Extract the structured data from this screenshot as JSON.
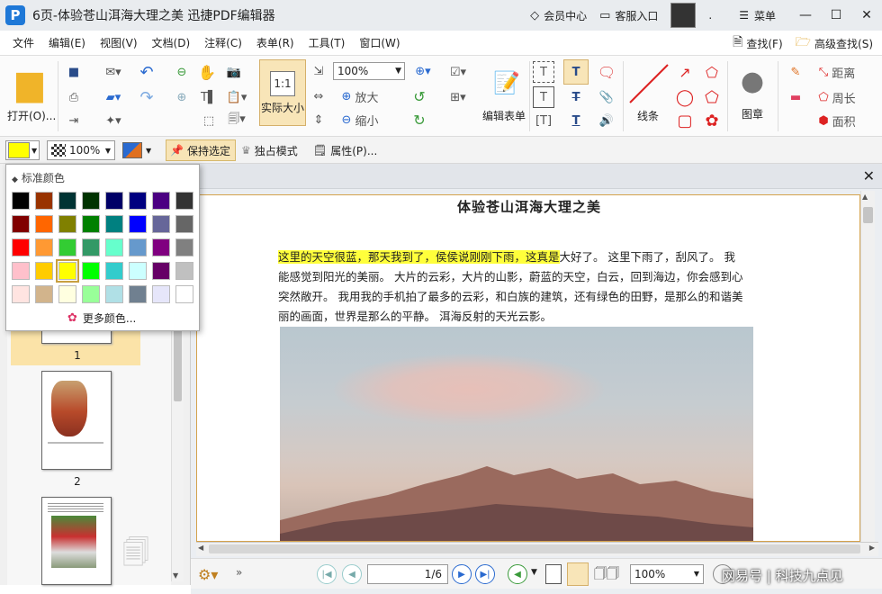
{
  "window": {
    "title": "6页-体验苍山洱海大理之美  迅捷PDF编辑器",
    "member_center": "会员中心",
    "service": "客服入口",
    "dot": ".",
    "menu": "菜单"
  },
  "menubar": {
    "items": [
      "文件",
      "编辑(E)",
      "视图(V)",
      "文档(D)",
      "注释(C)",
      "表单(R)",
      "工具(T)",
      "窗口(W)"
    ],
    "find": "查找(F)",
    "advanced_find": "高级查找(S)"
  },
  "ribbon": {
    "open": "打开(O)...",
    "actual_size": "实际大小",
    "zoom_value": "100%",
    "zoom_in": "放大",
    "zoom_out": "缩小",
    "edit_form": "编辑表单",
    "line": "线条",
    "stamp": "图章",
    "distance": "距离",
    "perimeter": "周长",
    "area": "面积",
    "actual_icon_text": "1:1"
  },
  "props": {
    "opacity": "100%",
    "keep_selected": "保持选定",
    "exclusive_mode": "独占模式",
    "properties": "属性(P)..."
  },
  "palette": {
    "title": "标准颜色",
    "more": "更多颜色...",
    "colors": [
      "#000000",
      "#993300",
      "#003333",
      "#003300",
      "#000066",
      "#000080",
      "#4b0082",
      "#333333",
      "#800000",
      "#ff6600",
      "#808000",
      "#008000",
      "#008080",
      "#0000ff",
      "#666699",
      "#666666",
      "#ff0000",
      "#ff9933",
      "#33cc33",
      "#339966",
      "#66ffcc",
      "#6699cc",
      "#800080",
      "#808080",
      "#ffc0cb",
      "#ffcc00",
      "#ffff00",
      "#00ff00",
      "#33cccc",
      "#ccffff",
      "#660066",
      "#c0c0c0",
      "#ffe4e1",
      "#d2b48c",
      "#ffffe0",
      "#99ff99",
      "#b0e0e6",
      "#708090",
      "#e6e6fa",
      "#ffffff"
    ],
    "selected_index": 26
  },
  "thumbnails": {
    "labels": [
      "1",
      "2"
    ]
  },
  "document": {
    "title": "体验苍山洱海大理之美",
    "highlighted": "这里的天空很蓝，那天我到了，侯侯说刚刚下雨，这真是",
    "para_line1_rest": "大好了。  这里下雨了，刮风了。  我",
    "para_line2": "能感觉到阳光的美丽。  大片的云彩，大片的山影，蔚蓝的天空，白云，回到海边，你会感到心",
    "para_line3": "突然敞开。  我用我的手机拍了最多的云彩，和白族的建筑，还有绿色的田野，是那么的和谐美",
    "para_line4": "丽的画面，世界是那么的平静。  洱海反射的天光云影。"
  },
  "bottom": {
    "page_input": "1/6",
    "zoom": "100%",
    "watermark": "网易号 | 科技九点见"
  }
}
